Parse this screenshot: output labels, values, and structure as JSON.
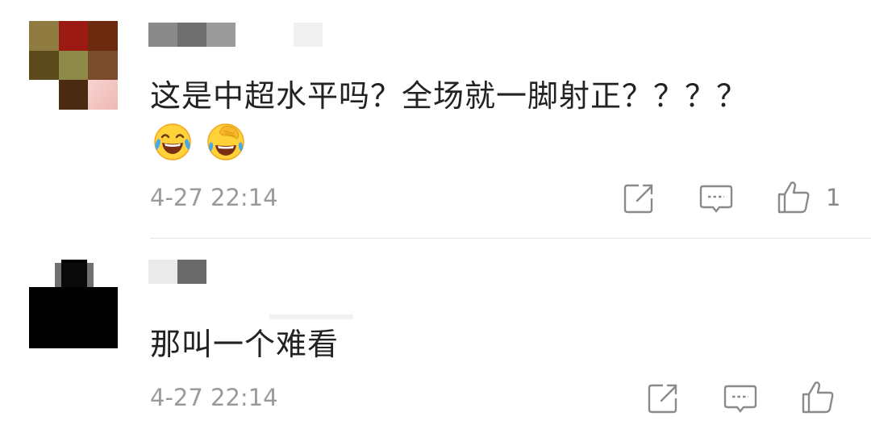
{
  "comments": [
    {
      "text": "这是中超水平吗？全场就一脚射正？？？？",
      "emojis": [
        "laughing-tears-emoji",
        "facepalm-crying-emoji"
      ],
      "timestamp": "4-27 22:14",
      "like_count": "1",
      "avatar_colors": [
        "#8f7a3f",
        "#9b1a14",
        "#6d2a0f",
        "#5a4a1c",
        "#8e8a4a",
        "#7a4b2c",
        "#ffffff",
        "#4a2a12",
        "#f3c9c6"
      ]
    },
    {
      "text": "那叫一个难看",
      "emojis": [],
      "timestamp": "4-27 22:14",
      "like_count": "",
      "avatar_colors": [
        "#000000"
      ]
    }
  ],
  "icons": {
    "share": "share-icon",
    "reply": "comment-icon",
    "like": "thumbs-up-icon"
  },
  "colors": {
    "text": "#222222",
    "meta": "#9a9a9a",
    "divider": "#e6e6e6"
  }
}
